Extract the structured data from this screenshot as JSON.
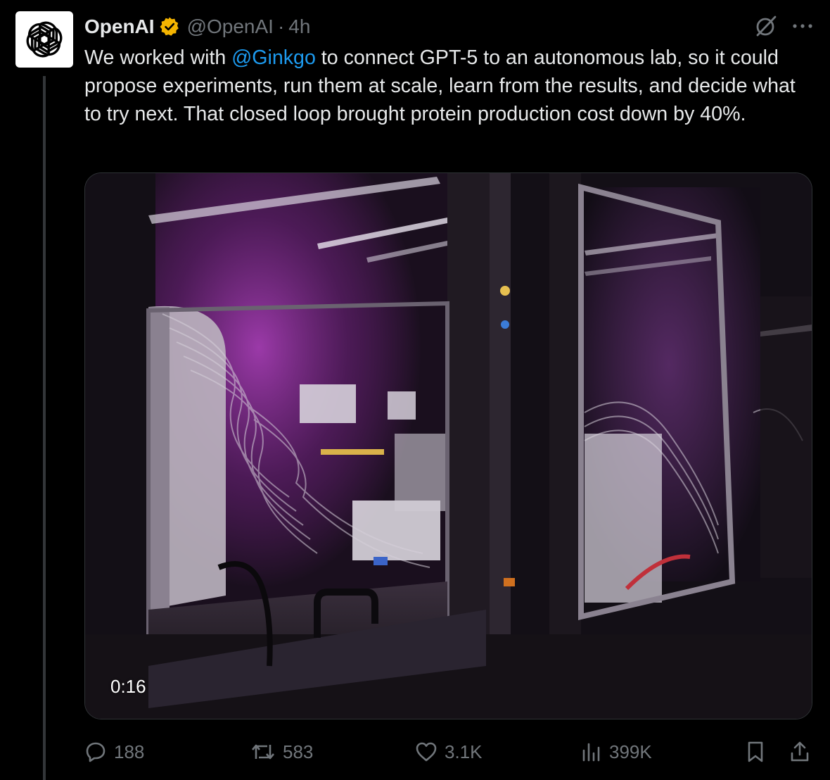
{
  "post": {
    "author": {
      "name": "OpenAI",
      "handle": "@OpenAI",
      "separator": "·",
      "time": "4h",
      "avatar_icon": "openai-logo-icon",
      "verified_badge_color": "#f4b400"
    },
    "text": {
      "before_mention": "We worked with ",
      "mention": "@Ginkgo",
      "after_mention": " to connect GPT-5 to an autonomous lab, so it could propose experiments, run them at scale, learn from the results, and decide what to try next. That closed loop brought protein production cost down by 40%."
    },
    "media": {
      "type": "video",
      "duration": "0:16"
    },
    "stats": {
      "replies": "188",
      "reposts": "583",
      "likes": "3.1K",
      "views": "399K"
    }
  },
  "colors": {
    "background": "#000000",
    "text": "#e7e9ea",
    "muted": "#71767b",
    "link": "#1d9bf0",
    "border": "#2f3336"
  }
}
